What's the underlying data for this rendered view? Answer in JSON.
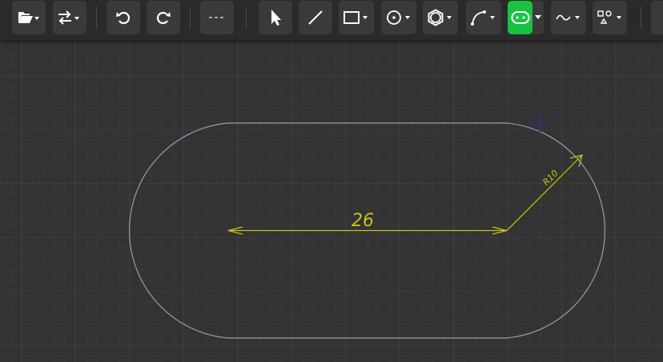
{
  "toolbar": {
    "line_style_label": "---",
    "tools": [
      "open-file",
      "import-export",
      "undo",
      "redo",
      "line-style",
      "select",
      "line",
      "rectangle",
      "circle",
      "polygon",
      "arc",
      "slot",
      "spline",
      "shapes"
    ],
    "active_tool": "slot",
    "active_color": "#19c341"
  },
  "drawing": {
    "shape": "slot",
    "stroke_color": "#9a9ab8",
    "dimension_color": "#c8c21a",
    "dimensions": {
      "length_label": "26",
      "radius_label": "R10"
    }
  },
  "colors": {
    "background": "#333333",
    "toolbar": "#2a2a2a",
    "button": "#3a3a3a",
    "grid_minor": "#3b3b3b",
    "grid_major": "#454545"
  }
}
